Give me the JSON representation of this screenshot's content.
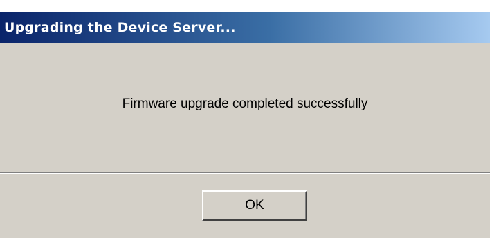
{
  "window": {
    "title": "Upgrading the Device Server..."
  },
  "message": {
    "text": "Firmware upgrade completed successfully"
  },
  "buttons": {
    "ok_label": "OK"
  },
  "colors": {
    "titlebar_start": "#0a246a",
    "titlebar_end": "#a6caf0",
    "dialog_background": "#d4d0c8"
  }
}
